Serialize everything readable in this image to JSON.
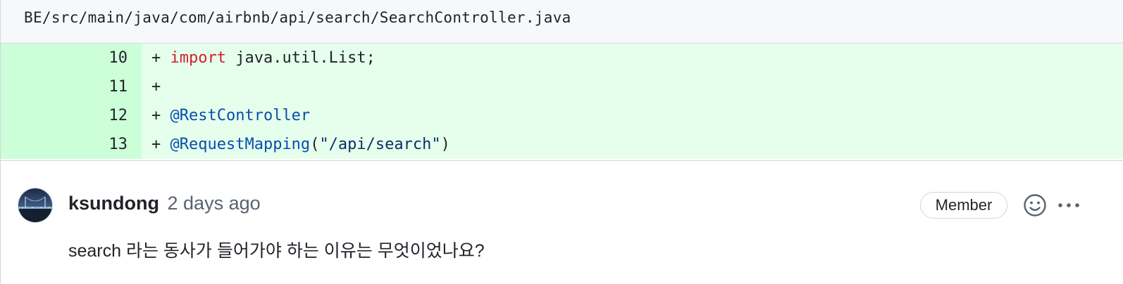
{
  "file": {
    "path": "BE/src/main/java/com/airbnb/api/search/SearchController.java"
  },
  "diff": {
    "lines": [
      {
        "number": "10",
        "prefix": "+ ",
        "tokens": [
          {
            "type": "kw",
            "text": "import"
          },
          {
            "type": "plain",
            "text": " java.util.List;"
          }
        ]
      },
      {
        "number": "11",
        "prefix": "+",
        "tokens": []
      },
      {
        "number": "12",
        "prefix": "+ ",
        "tokens": [
          {
            "type": "ann",
            "text": "@RestController"
          }
        ]
      },
      {
        "number": "13",
        "prefix": "+ ",
        "tokens": [
          {
            "type": "ann",
            "text": "@RequestMapping"
          },
          {
            "type": "plain",
            "text": "("
          },
          {
            "type": "str",
            "text": "\"/api/search\""
          },
          {
            "type": "plain",
            "text": ")"
          }
        ]
      }
    ]
  },
  "comment": {
    "author": "ksundong",
    "time": "2 days ago",
    "role": "Member",
    "body": "search 라는 동사가 들어가야 하는 이유는 무엇이었나요?",
    "icons": {
      "reaction": "smiley-icon",
      "more": "kebab-horizontal-icon"
    }
  },
  "colors": {
    "addition_line": "#e6ffec",
    "addition_gutter": "#ccffd8",
    "keyword": "#cf222e",
    "annotation": "#0550ae",
    "string": "#0a3069"
  }
}
